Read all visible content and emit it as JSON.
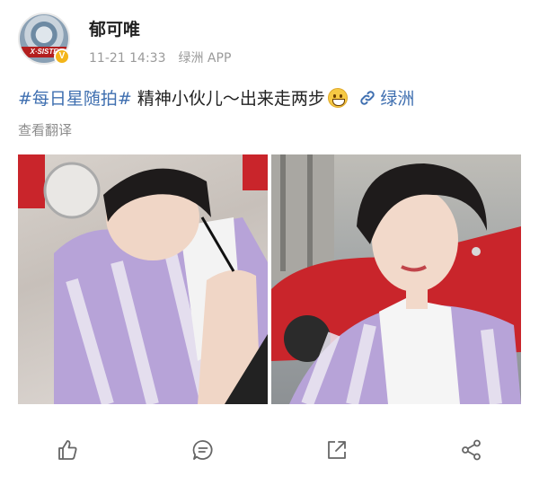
{
  "post": {
    "author": "郁可唯",
    "avatar_text": "X·SISTE",
    "verified_badge": "V",
    "date": "11-21 14:33",
    "source": "绿洲 APP",
    "topic": "#每日星随拍#",
    "text": " 精神小伙儿～出来走两步",
    "link_label": "绿洲",
    "translate_label": "查看翻译"
  },
  "colors": {
    "link_blue": "#3f6fb0",
    "sweater_purple": "#b7a3d8",
    "car_red": "#c9252b",
    "meta_grey": "#9a9a9a"
  },
  "actions": {
    "like_icon": "thumbs-up-icon",
    "comment_icon": "comment-icon",
    "repost_icon": "repost-icon",
    "share_icon": "share-icon"
  }
}
